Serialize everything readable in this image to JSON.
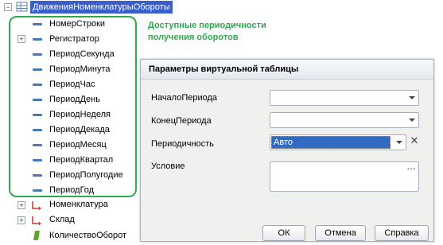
{
  "tree": {
    "root_label": "ДвиженияНоменклатурыОбороты",
    "fields": [
      {
        "label": "НомерСтроки",
        "expandable": false
      },
      {
        "label": "Регистратор",
        "expandable": true
      },
      {
        "label": "ПериодСекунда",
        "expandable": false
      },
      {
        "label": "ПериодМинута",
        "expandable": false
      },
      {
        "label": "ПериодЧас",
        "expandable": false
      },
      {
        "label": "ПериодДень",
        "expandable": false
      },
      {
        "label": "ПериодНеделя",
        "expandable": false
      },
      {
        "label": "ПериодДекада",
        "expandable": false
      },
      {
        "label": "ПериодМесяц",
        "expandable": false
      },
      {
        "label": "ПериодКвартал",
        "expandable": false
      },
      {
        "label": "ПериодПолугодие",
        "expandable": false
      },
      {
        "label": "ПериодГод",
        "expandable": false
      }
    ],
    "dimensions": [
      {
        "label": "Номенклатура",
        "icon": "dimension-icon"
      },
      {
        "label": "Склад",
        "icon": "dimension-icon"
      }
    ],
    "resources": [
      {
        "label": "КоличествоОборот",
        "icon": "resource-icon"
      }
    ]
  },
  "note": {
    "text": "Доступные периодичности получения оборотов",
    "color": "#2fa84f"
  },
  "dialog": {
    "title": "Параметры виртуальной таблицы",
    "start_label": "НачалоПериода",
    "start_value": "",
    "end_label": "КонецПериода",
    "end_value": "",
    "period_label": "Периодичность",
    "period_value": "Авто",
    "condition_label": "Условие",
    "condition_value": "",
    "ok_label": "ОК",
    "cancel_label": "Отмена",
    "help_label": "Справка"
  },
  "colors": {
    "selection": "#3a5fcd",
    "highlight_border": "#2fa84f"
  }
}
